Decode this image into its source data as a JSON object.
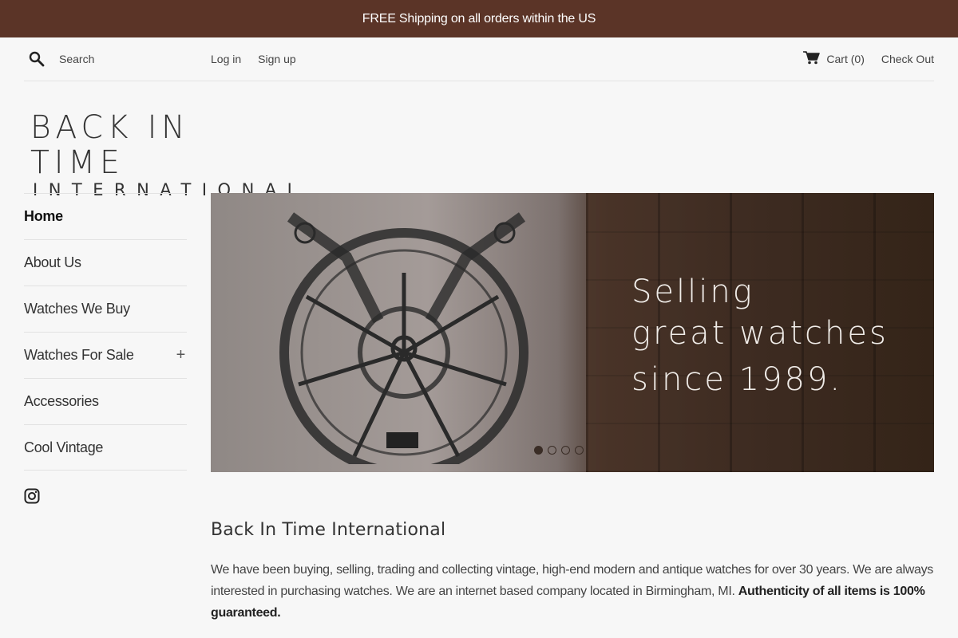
{
  "announcement": {
    "text": "FREE Shipping on all orders within the US"
  },
  "header": {
    "search_placeholder": "Search",
    "login_label": "Log in",
    "signup_label": "Sign up",
    "cart_label": "Cart (",
    "cart_count": "0",
    "cart_close": ")",
    "checkout_label": "Check Out"
  },
  "logo": {
    "line1": "BACK IN TIME",
    "line2": "INTERNATIONAL"
  },
  "sidebar": {
    "items": [
      {
        "label": "Home",
        "active": true
      },
      {
        "label": "About Us"
      },
      {
        "label": "Watches We Buy"
      },
      {
        "label": "Watches For Sale",
        "expandable": true,
        "expand_symbol": "+"
      },
      {
        "label": "Accessories"
      },
      {
        "label": "Cool Vintage"
      }
    ],
    "social_icon": "instagram-icon"
  },
  "hero": {
    "line1": "Selling",
    "line2": "great watches",
    "line3": "since 1989.",
    "slide_count": 4,
    "active_slide": 1
  },
  "main": {
    "title": "Back In Time International",
    "body": "We have been buying, selling, trading and collecting vintage, high-end modern and antique watches for over 30 years. We are always interested in purchasing watches. We are an internet based company located in Birmingham, MI. ",
    "body_bold": "Authenticity of all items is 100% guaranteed."
  },
  "colors": {
    "announcement_bg": "#5b3427",
    "page_bg": "#f7f7f7",
    "text": "#333333"
  }
}
